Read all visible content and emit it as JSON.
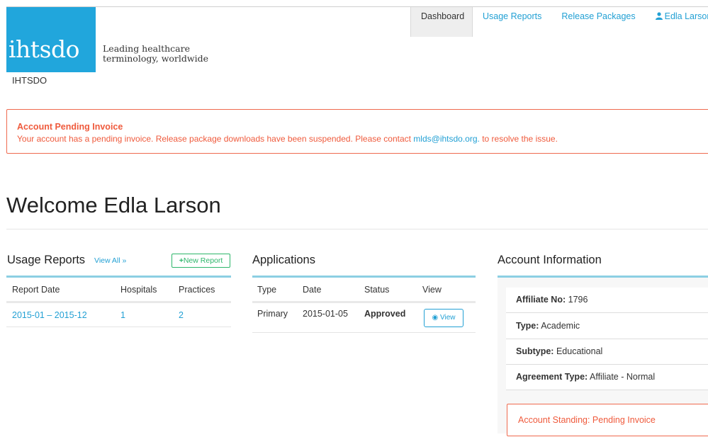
{
  "brand": {
    "logo_text": "ihtsdo",
    "tagline_1": "Leading healthcare",
    "tagline_2": "terminology, worldwide",
    "org_name": "IHTSDO",
    "logo_color": "#21a6dc"
  },
  "nav": {
    "dashboard": "Dashboard",
    "usage_reports": "Usage Reports",
    "release_packages": "Release Packages",
    "user": "Edla Larson"
  },
  "alert": {
    "title": "Account Pending Invoice",
    "message_before": "Your account has a pending invoice. Release package downloads have been suspended. Please contact ",
    "email": "mlds@ihtsdo.org.",
    "message_after": " to resolve the issue.",
    "color": "#ef5a3c"
  },
  "welcome": "Welcome Edla Larson",
  "usage_reports": {
    "title": "Usage Reports",
    "view_all": "View All »",
    "new_report": "New Report",
    "columns": [
      "Report Date",
      "Hospitals",
      "Practices"
    ],
    "rows": [
      {
        "date": "2015-01 – 2015-12",
        "hospitals": "1",
        "practices": "2"
      }
    ]
  },
  "applications": {
    "title": "Applications",
    "columns": [
      "Type",
      "Date",
      "Status",
      "View"
    ],
    "rows": [
      {
        "type": "Primary",
        "date": "2015-01-05",
        "status": "Approved",
        "view": "View"
      }
    ]
  },
  "account": {
    "title": "Account Information",
    "affiliate_label": "Affiliate No:",
    "affiliate_value": "1796",
    "type_label": "Type:",
    "type_value": "Academic",
    "subtype_label": "Subtype:",
    "subtype_value": "Educational",
    "agreement_label": "Agreement Type:",
    "agreement_value": "Affiliate - Normal",
    "standing": "Account Standing: Pending Invoice"
  },
  "colors": {
    "link": "#22a0d4",
    "success": "#2db66a",
    "accent_bar": "#8ccfe3"
  }
}
